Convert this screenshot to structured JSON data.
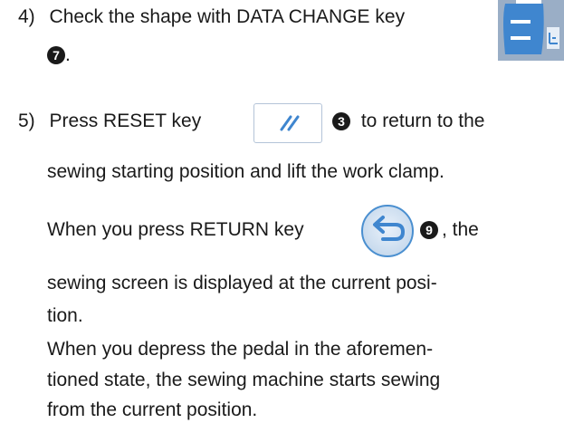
{
  "step4": {
    "number": "4)",
    "text": "Check the shape with DATA CHANGE key",
    "badge": "7",
    "tail": "."
  },
  "step5": {
    "number": "5)",
    "text_a": "Press RESET key",
    "badge_reset": "3",
    "text_b": "to return to the",
    "line2": "sewing starting position and lift the work clamp.",
    "line3_a": "When you press RETURN key",
    "badge_return": "9",
    "line3_b": ", the",
    "line4": "sewing screen is displayed at the current posi-",
    "line5": "tion.",
    "line6": "When you depress the pedal in the aforemen-",
    "line7": "tioned state, the sewing machine starts sewing",
    "line8": "from the current position."
  },
  "icons": {
    "data_change": "data-change-key-icon",
    "reset": "reset-key-icon",
    "return": "return-key-icon"
  },
  "colors": {
    "text": "#1a1a1a",
    "key_blue": "#4a8fd0",
    "data_key_bg": "#9aaec6"
  }
}
